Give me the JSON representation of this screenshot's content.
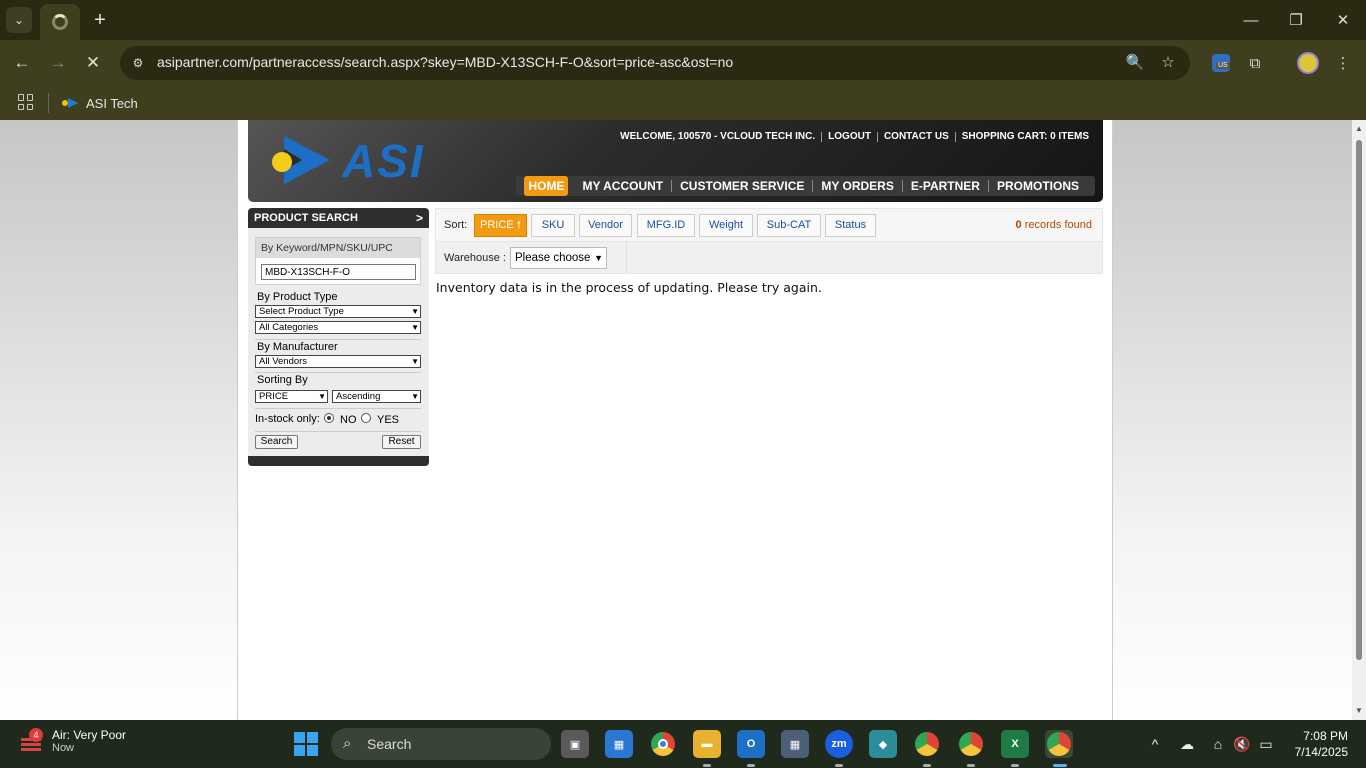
{
  "browser": {
    "url": "asipartner.com/partneraccess/search.aspx?skey=MBD-X13SCH-F-O&sort=price-asc&ost=no",
    "bookmark": "ASI Tech",
    "extension_badge": "US"
  },
  "header": {
    "welcome": "WELCOME, 100570 - VCLOUD TECH INC.",
    "logout": "LOGOUT",
    "contact": "CONTACT US",
    "cart": "SHOPPING CART: 0 ITEMS",
    "logo_text": "ASI",
    "nav": [
      "HOME",
      "MY ACCOUNT",
      "CUSTOMER SERVICE",
      "MY ORDERS",
      "E-PARTNER",
      "PROMOTIONS"
    ]
  },
  "sidebar": {
    "title": "PRODUCT SEARCH",
    "keyword_label": "By Keyword/MPN/SKU/UPC",
    "keyword_value": "MBD-X13SCH-F-O",
    "product_type_label": "By Product Type",
    "product_type_value": "Select Product Type",
    "category_value": "All Categories",
    "manufacturer_label": "By Manufacturer",
    "manufacturer_value": "All Vendors",
    "sorting_label": "Sorting By",
    "sort_field_value": "PRICE",
    "sort_order_value": "Ascending",
    "instock_label": "In-stock only:",
    "instock_no": "NO",
    "instock_yes": "YES",
    "search_button": "Search",
    "reset_button": "Reset"
  },
  "sortbar": {
    "label": "Sort:",
    "buttons": [
      "PRICE",
      "SKU",
      "Vendor",
      "MFG.ID",
      "Weight",
      "Sub-CAT",
      "Status"
    ],
    "active_arrow": "🠕",
    "records_count": "0",
    "records_text": "records found"
  },
  "warehouse": {
    "label": "Warehouse :",
    "value": "Please choose"
  },
  "message": "Inventory data is in the process of updating. Please try again.",
  "taskbar": {
    "weather_title": "Air: Very Poor",
    "weather_sub": "Now",
    "weather_badge": "4",
    "search_placeholder": "Search",
    "time": "7:08 PM",
    "date": "7/14/2025"
  }
}
